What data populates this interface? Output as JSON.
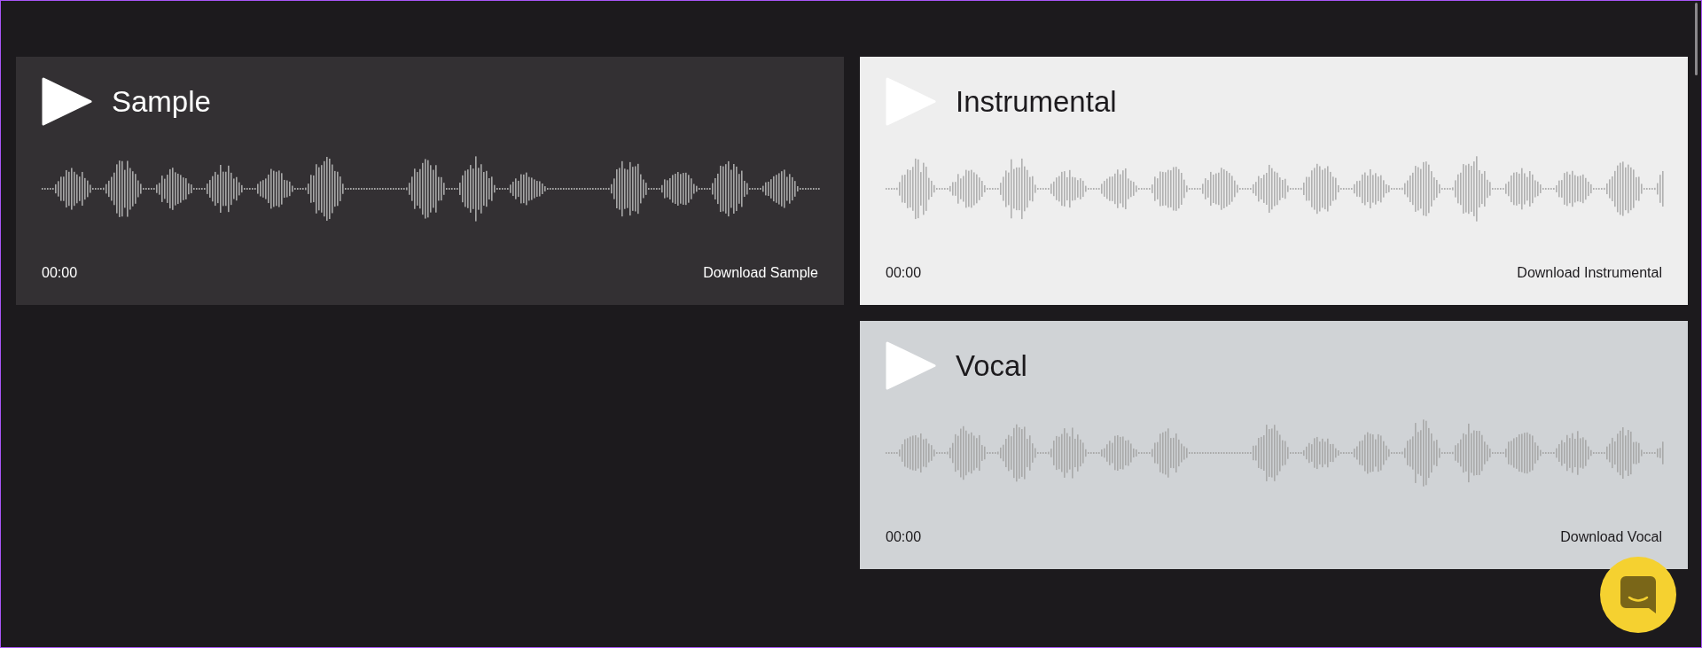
{
  "players": [
    {
      "title": "Sample",
      "kind": "dark",
      "time": "00:00",
      "download": "Download Sample"
    },
    {
      "title": "Instrumental",
      "kind": "light",
      "time": "00:00",
      "download": "Download Instrumental"
    },
    {
      "title": "Vocal",
      "kind": "gray",
      "time": "00:00",
      "download": "Download Vocal"
    }
  ]
}
